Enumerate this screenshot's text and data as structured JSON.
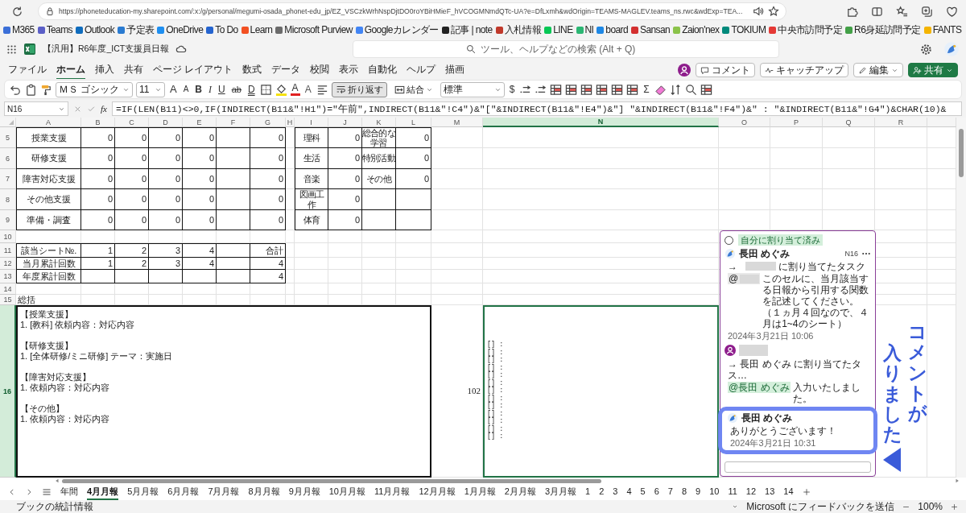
{
  "browser": {
    "url": "https://phoneteducation-my.sharepoint.com/:x:/g/personal/megumi-osada_phonet-edu_jp/EZ_VSCzkWrhNspDjtDO0roYBiHMieF_hVCOGMNmdQTc-UA?e=DfLxmh&wdOrigin=TEAMS-MAGLEV.teams_ns.rwc&wdExp=TEA..."
  },
  "bookmarks": [
    {
      "label": "M365",
      "color": "#3b6fd8"
    },
    {
      "label": "Teams",
      "color": "#5b5fc7"
    },
    {
      "label": "Outlook",
      "color": "#0f6cbd"
    },
    {
      "label": "予定表",
      "color": "#2a7bd1"
    },
    {
      "label": "OneDrive",
      "color": "#1f8ff0"
    },
    {
      "label": "To Do",
      "color": "#2564cf"
    },
    {
      "label": "Learn",
      "color": "#f25022"
    },
    {
      "label": "Microsoft Purview",
      "color": "#6b6b6b"
    },
    {
      "label": "Googleカレンダー",
      "color": "#4285f4"
    },
    {
      "label": "記事 | note",
      "color": "#222222"
    },
    {
      "label": "入札情報",
      "color": "#c0392b"
    },
    {
      "label": "LINE",
      "color": "#06c755"
    },
    {
      "label": "NI",
      "color": "#2bb673"
    },
    {
      "label": "board",
      "color": "#1e88e5"
    },
    {
      "label": "Sansan",
      "color": "#d32f2f"
    },
    {
      "label": "Zaion'nex",
      "color": "#8bc34a"
    },
    {
      "label": "TOKIUM",
      "color": "#00897b"
    },
    {
      "label": "中央市訪問予定",
      "color": "#e53935"
    },
    {
      "label": "R6身延訪問予定",
      "color": "#43a047"
    },
    {
      "label": "FANTS",
      "color": "#f4b400"
    }
  ],
  "app": {
    "title": "【汎用】R6年度_ICT支援員日報",
    "search": {
      "placeholder": "ツール、ヘルプなどの検索 (Alt + Q)"
    }
  },
  "ribbon_tabs": [
    {
      "label": "ファイル",
      "selected": false
    },
    {
      "label": "ホーム",
      "selected": true
    },
    {
      "label": "挿入",
      "selected": false
    },
    {
      "label": "共有",
      "selected": false
    },
    {
      "label": "ページ レイアウト",
      "selected": false
    },
    {
      "label": "数式",
      "selected": false
    },
    {
      "label": "データ",
      "selected": false
    },
    {
      "label": "校閲",
      "selected": false
    },
    {
      "label": "表示",
      "selected": false
    },
    {
      "label": "自動化",
      "selected": false
    },
    {
      "label": "ヘルプ",
      "selected": false
    },
    {
      "label": "描画",
      "selected": false
    }
  ],
  "ribbon_actions": [
    {
      "kind": "comment",
      "label": "コメント"
    },
    {
      "kind": "catchup",
      "label": "キャッチアップ"
    },
    {
      "kind": "edit",
      "label": "編集"
    },
    {
      "kind": "share",
      "label": "共有"
    }
  ],
  "toolbar": [
    {
      "kind": "undo"
    },
    {
      "kind": "paste"
    },
    {
      "kind": "painter"
    },
    {
      "kind": "font",
      "value": "ＭＳ ゴシック"
    },
    {
      "kind": "size",
      "value": "11"
    },
    {
      "kind": "grow",
      "label": "A"
    },
    {
      "kind": "shrink",
      "label": "A"
    },
    {
      "kind": "bold",
      "label": "B"
    },
    {
      "kind": "italic",
      "label": "I"
    },
    {
      "kind": "underline",
      "label": "U"
    },
    {
      "kind": "strike",
      "label": "ab"
    },
    {
      "kind": "dunder",
      "label": "D"
    },
    {
      "kind": "borders"
    },
    {
      "kind": "fill"
    },
    {
      "kind": "fontcolor",
      "label": "A"
    },
    {
      "kind": "super",
      "label": "A"
    },
    {
      "kind": "align"
    },
    {
      "kind": "wrap",
      "label": "折り返す",
      "on": true
    },
    {
      "kind": "merge",
      "label": "結合"
    },
    {
      "kind": "format",
      "value": "標準"
    },
    {
      "kind": "currency",
      "label": "$"
    },
    {
      "kind": "decimal"
    },
    {
      "kind": "decimal"
    },
    {
      "kind": "table"
    },
    {
      "kind": "table"
    },
    {
      "kind": "table"
    },
    {
      "kind": "table"
    },
    {
      "kind": "table"
    },
    {
      "kind": "table"
    },
    {
      "kind": "sum",
      "label": "Σ"
    },
    {
      "kind": "eraser"
    },
    {
      "kind": "sort"
    },
    {
      "kind": "find"
    },
    {
      "kind": "table"
    }
  ],
  "formula_bar": {
    "name_box": "N16",
    "fx": "fx",
    "formula": "=IF(LEN(B11)<>0,IF(INDIRECT(B11&\"!H1\")=\"午前\",INDIRECT(B11&\"!C4\")&\"[\"&INDIRECT(B11&\"!E4\")&\"] \"&INDIRECT(B11&\"!F4\")&\" : \"&INDIRECT(B11&\"!G4\")&CHAR(10)&"
  },
  "columns": [
    {
      "label": "A",
      "selected": false
    },
    {
      "label": "B",
      "selected": false
    },
    {
      "label": "C",
      "selected": false
    },
    {
      "label": "D",
      "selected": false
    },
    {
      "label": "E",
      "selected": false
    },
    {
      "label": "F",
      "selected": false
    },
    {
      "label": "G",
      "selected": false
    },
    {
      "label": "H",
      "selected": false
    },
    {
      "label": "I",
      "selected": false
    },
    {
      "label": "J",
      "selected": false
    },
    {
      "label": "K",
      "selected": false
    },
    {
      "label": "L",
      "selected": false
    },
    {
      "label": "M",
      "selected": false
    },
    {
      "label": "N",
      "selected": true
    },
    {
      "label": "O",
      "selected": false
    },
    {
      "label": "P",
      "selected": false
    },
    {
      "label": "Q",
      "selected": false
    },
    {
      "label": "R",
      "selected": false
    }
  ],
  "rows": [
    {
      "number": "5",
      "kind": "table",
      "selected": false,
      "cells": [
        "授業支援",
        "0",
        "0",
        "0",
        "0",
        null,
        "0",
        null,
        "理科",
        "0",
        "総合的な学習",
        "0"
      ]
    },
    {
      "number": "6",
      "kind": "table",
      "selected": false,
      "cells": [
        "研修支援",
        "0",
        "0",
        "0",
        "0",
        null,
        "0",
        null,
        "生活",
        "0",
        "特別活動",
        "0"
      ]
    },
    {
      "number": "7",
      "kind": "table",
      "selected": false,
      "cells": [
        "障害対応支援",
        "0",
        "0",
        "0",
        "0",
        null,
        "0",
        null,
        "音楽",
        "0",
        "その他",
        "0"
      ]
    },
    {
      "number": "8",
      "kind": "table",
      "selected": false,
      "cells": [
        "その他支援",
        "0",
        "0",
        "0",
        "0",
        null,
        "0",
        null,
        "図画工作",
        "0",
        null,
        null
      ]
    },
    {
      "number": "9",
      "kind": "table",
      "selected": false,
      "cells": [
        "準備・調査",
        "0",
        "0",
        "0",
        "0",
        null,
        "0",
        null,
        "体育",
        "0",
        null,
        null
      ]
    },
    {
      "number": "10",
      "kind": "blank",
      "selected": false
    },
    {
      "number": "11",
      "kind": "table",
      "selected": false,
      "cells": [
        "該当シート№.",
        "1",
        "2",
        "3",
        "4",
        null,
        "合計"
      ]
    },
    {
      "number": "12",
      "kind": "table",
      "selected": false,
      "cells": [
        "当月累計回数",
        "1",
        "2",
        "3",
        "4",
        null,
        "4"
      ]
    },
    {
      "number": "13",
      "kind": "table",
      "selected": false,
      "cells": [
        "年度累計回数",
        null,
        null,
        null,
        null,
        null,
        "4"
      ]
    },
    {
      "number": "14",
      "kind": "blank",
      "selected": false
    },
    {
      "number": "15",
      "kind": "label",
      "selected": false,
      "cells": [
        "総括"
      ]
    },
    {
      "number": "16",
      "kind": "summary",
      "selected": true,
      "sections": [
        {
          "heading": "【授業支援】",
          "line": "1. [教科] 依頼内容：対応内容"
        },
        {
          "heading": "【研修支援】",
          "line": "1. [全体研修/ミニ研修] テーマ：実施日"
        },
        {
          "heading": "【障害対応支援】",
          "line": "1. 依頼内容：対応内容"
        },
        {
          "heading": "【その他】",
          "line": "1. 依頼内容：対応内容"
        }
      ],
      "count": "102",
      "list_lines": [
        "[] :",
        "[] :",
        "[] :",
        "[] :",
        "[] :",
        "[] :",
        "[] :",
        "[] :",
        "[] :",
        "[] :",
        "[] :",
        "[] :",
        "[] :"
      ]
    }
  ],
  "comment": {
    "resolved": false,
    "tag": "自分に割り当て済み",
    "cell": "N16",
    "posts": [
      {
        "kind": "thread",
        "highlighted": false,
        "author": {
          "kind": "name",
          "text": "長田 めぐみ"
        },
        "paragraphs": [
          [
            {
              "kind": "text",
              "text": "→"
            },
            {
              "kind": "redacted"
            },
            {
              "kind": "text",
              "text": "に割り当てたタスク"
            }
          ],
          [
            {
              "kind": "mention",
              "text": "@",
              "redacted": true
            },
            {
              "kind": "text",
              "text": "このセルに、当月該当する日報から引用する関数を記述してください。（１ヵ月４回なので、４月は1~4のシート）"
            }
          ]
        ],
        "date": "2024年3月21日 10:06"
      },
      {
        "kind": "reply",
        "highlighted": false,
        "author": {
          "kind": "redacted"
        },
        "paragraphs": [
          [
            {
              "kind": "text",
              "text": "→ 長田 めぐみ に割り当てたタス…"
            }
          ],
          [
            {
              "kind": "mention",
              "text": "@長田 めぐみ",
              "redacted": false
            },
            {
              "kind": "text",
              "text": "入力いたしました。"
            }
          ]
        ]
      },
      {
        "kind": "reply",
        "highlighted": true,
        "author": {
          "kind": "name",
          "text": "長田 めぐみ"
        },
        "paragraphs": [
          [
            {
              "kind": "text",
              "text": "ありがとうございます！"
            }
          ]
        ],
        "date": "2024年3月21日 10:31"
      }
    ]
  },
  "annotation": {
    "lines": [
      "コメントが",
      "入りました"
    ]
  },
  "sheet_tabs": [
    {
      "label": "年間",
      "selected": false
    },
    {
      "label": "4月月報",
      "selected": true
    },
    {
      "label": "5月月報",
      "selected": false
    },
    {
      "label": "6月月報",
      "selected": false
    },
    {
      "label": "7月月報",
      "selected": false
    },
    {
      "label": "8月月報",
      "selected": false
    },
    {
      "label": "9月月報",
      "selected": false
    },
    {
      "label": "10月月報",
      "selected": false
    },
    {
      "label": "11月月報",
      "selected": false
    },
    {
      "label": "12月月報",
      "selected": false
    },
    {
      "label": "1月月報",
      "selected": false
    },
    {
      "label": "2月月報",
      "selected": false
    },
    {
      "label": "3月月報",
      "selected": false
    },
    {
      "label": "1",
      "selected": false
    },
    {
      "label": "2",
      "selected": false
    },
    {
      "label": "3",
      "selected": false
    },
    {
      "label": "4",
      "selected": false
    },
    {
      "label": "5",
      "selected": false
    },
    {
      "label": "6",
      "selected": false
    },
    {
      "label": "7",
      "selected": false
    },
    {
      "label": "8",
      "selected": false
    },
    {
      "label": "9",
      "selected": false
    },
    {
      "label": "10",
      "selected": false
    },
    {
      "label": "11",
      "selected": false
    },
    {
      "label": "12",
      "selected": false
    },
    {
      "label": "13",
      "selected": false
    },
    {
      "label": "14",
      "selected": false
    }
  ],
  "status_bar": {
    "left": "ブックの統計情報",
    "feedback": "Microsoft にフィードバックを送信",
    "zoom": "100%"
  }
}
